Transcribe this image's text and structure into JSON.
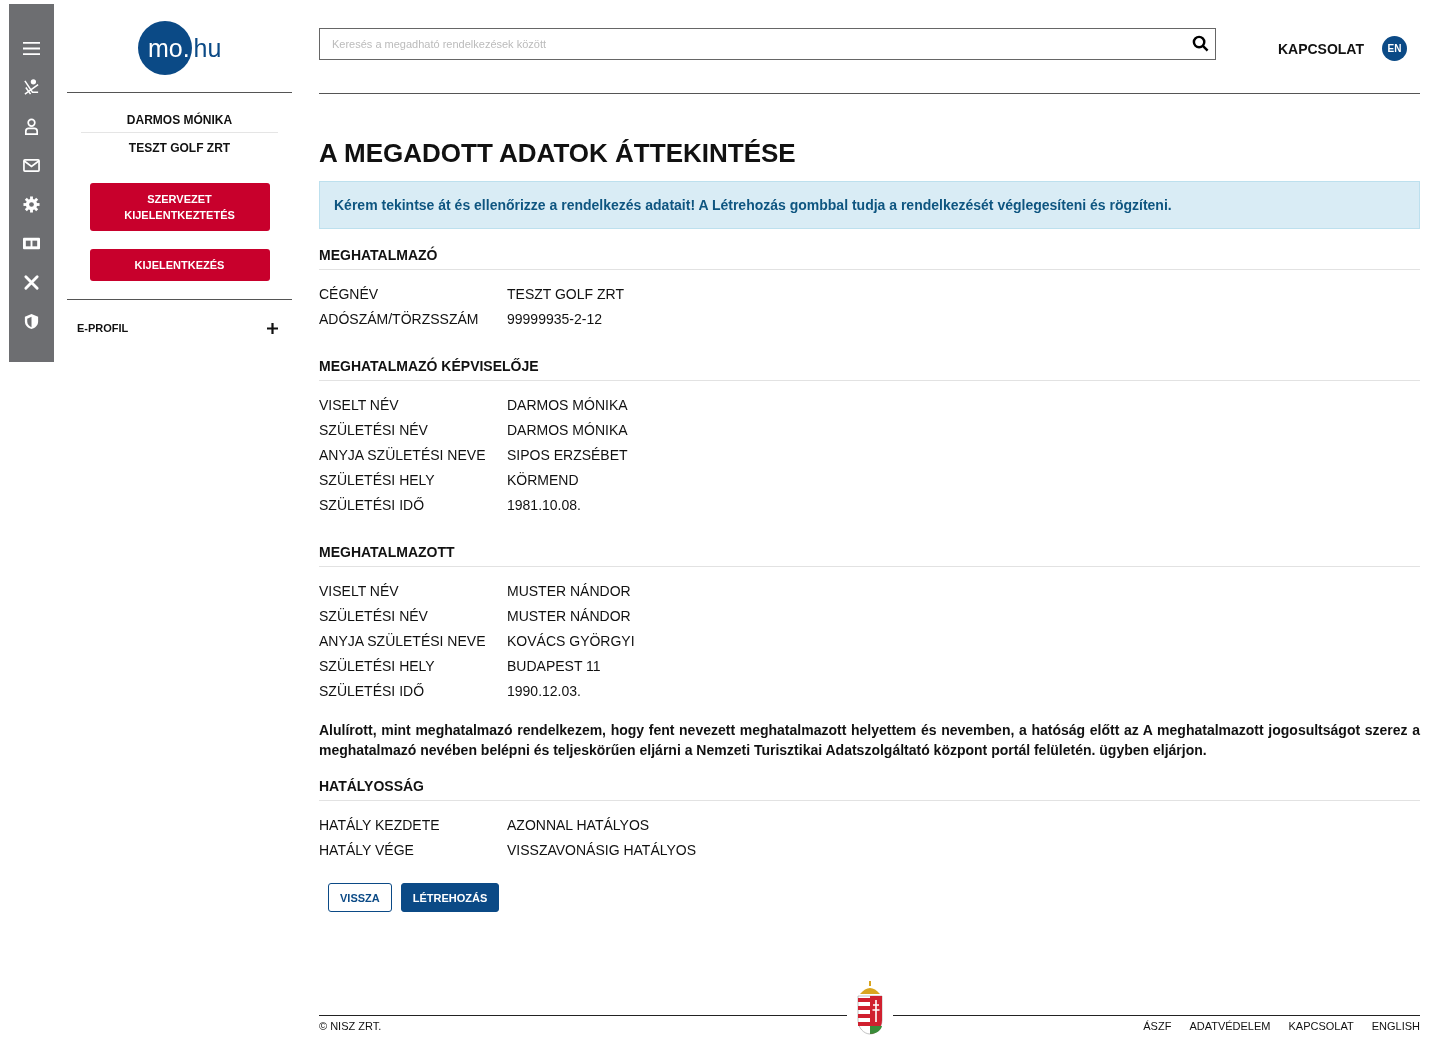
{
  "sidebar": {
    "logo": {
      "circle_text": "mo.",
      "side_text": "hu"
    },
    "user_name": "DARMOS MÓNIKA",
    "organization": "TESZT GOLF ZRT",
    "buttons": [
      "SZERVEZET KIJELENTKEZTETÉS",
      "KIJELENTKEZÉS"
    ],
    "menu": [
      {
        "label": "E-PROFIL",
        "expanded": false
      }
    ]
  },
  "header": {
    "search": {
      "placeholder": "Keresés a megadható rendelkezések között"
    },
    "contact": "KAPCSOLAT",
    "language": "EN"
  },
  "page": {
    "title": "A MEGADOTT ADATOK ÁTTEKINTÉSE",
    "notice": "Kérem tekintse át és ellenőrizze a rendelkezés adatait! A Létrehozás gombbal tudja a rendelkezését véglegesíteni és rögzíteni.",
    "blocks": [
      {
        "kind": "section",
        "heading": "MEGHATALMAZÓ",
        "rows": [
          {
            "label": "CÉGNÉV",
            "value": "TESZT GOLF ZRT"
          },
          {
            "label": "ADÓSZÁM/TÖRZSSZÁM",
            "value": "99999935-2-12"
          }
        ]
      },
      {
        "kind": "section",
        "heading": "MEGHATALMAZÓ KÉPVISELŐJE",
        "rows": [
          {
            "label": "VISELT NÉV",
            "value": "DARMOS MÓNIKA"
          },
          {
            "label": "SZÜLETÉSI NÉV",
            "value": "DARMOS MÓNIKA"
          },
          {
            "label": "ANYJA SZÜLETÉSI NEVE",
            "value": "SIPOS ERZSÉBET"
          },
          {
            "label": "SZÜLETÉSI HELY",
            "value": "KÖRMEND"
          },
          {
            "label": "SZÜLETÉSI IDŐ",
            "value": "1981.10.08."
          }
        ]
      },
      {
        "kind": "section",
        "heading": "MEGHATALMAZOTT",
        "rows": [
          {
            "label": "VISELT NÉV",
            "value": "MUSTER NÁNDOR"
          },
          {
            "label": "SZÜLETÉSI NÉV",
            "value": "MUSTER NÁNDOR"
          },
          {
            "label": "ANYJA SZÜLETÉSI NEVE",
            "value": "KOVÁCS GYÖRGYI"
          },
          {
            "label": "SZÜLETÉSI HELY",
            "value": "BUDAPEST 11"
          },
          {
            "label": "SZÜLETÉSI IDŐ",
            "value": "1990.12.03."
          }
        ]
      },
      {
        "kind": "statement",
        "text": "Alulírott, mint meghatalmazó rendelkezem, hogy fent nevezett meghatalmazott helyettem és nevemben, a hatóság előtt az A meghatalmazott jogosultságot szerez a meghatalmazó nevében belépni és teljeskörűen eljárni a Nemzeti Turisztikai Adatszolgáltató központ portál felületén. ügyben eljárjon."
      },
      {
        "kind": "section",
        "heading": "HATÁLYOSSÁG",
        "rows": [
          {
            "label": "HATÁLY KEZDETE",
            "value": "AZONNAL HATÁLYOS"
          },
          {
            "label": "HATÁLY VÉGE",
            "value": "VISSZAVONÁSIG HATÁLYOS"
          }
        ]
      }
    ],
    "buttons": [
      {
        "label": "VISSZA",
        "kind": "secondary"
      },
      {
        "label": "LÉTREHOZÁS",
        "kind": "primary"
      }
    ]
  },
  "footer": {
    "copyright": "© NISZ ZRT.",
    "links": [
      "ÁSZF",
      "ADATVÉDELEM",
      "KAPCSOLAT",
      "ENGLISH"
    ]
  }
}
